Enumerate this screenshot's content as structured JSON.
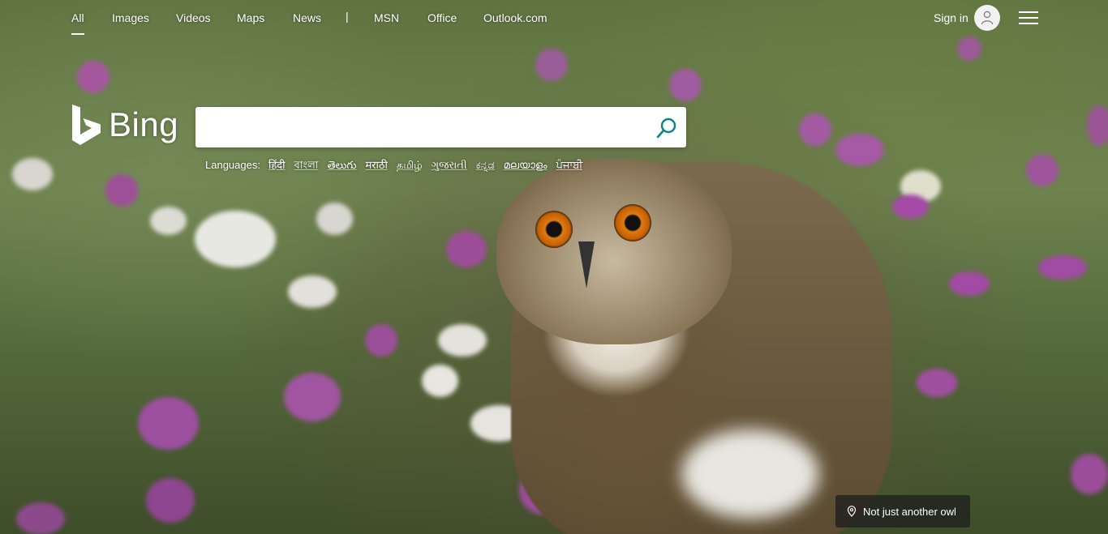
{
  "nav": {
    "items": [
      {
        "label": "All",
        "active": true
      },
      {
        "label": "Images"
      },
      {
        "label": "Videos"
      },
      {
        "label": "Maps"
      },
      {
        "label": "News"
      },
      {
        "label": "MSN"
      },
      {
        "label": "Office"
      },
      {
        "label": "Outlook.com"
      }
    ],
    "separator": "|",
    "signin_label": "Sign in"
  },
  "logo": {
    "text": "Bing"
  },
  "search": {
    "value": "",
    "placeholder": ""
  },
  "languages": {
    "label": "Languages:",
    "items": [
      "हिंदी",
      "বাংলা",
      "తెలుగు",
      "मराठी",
      "தமிழ்",
      "ગુજરાતી",
      "ಕನ್ನಡ",
      "മലയാളം",
      "ਪੰਜਾਬੀ"
    ]
  },
  "caption": {
    "text": "Not just another owl"
  },
  "colors": {
    "accent": "#0c8484",
    "nav_text": "#ffffff"
  },
  "icons": [
    "bing-logo-icon",
    "search-icon",
    "user-icon",
    "menu-icon",
    "location-pin-icon"
  ]
}
